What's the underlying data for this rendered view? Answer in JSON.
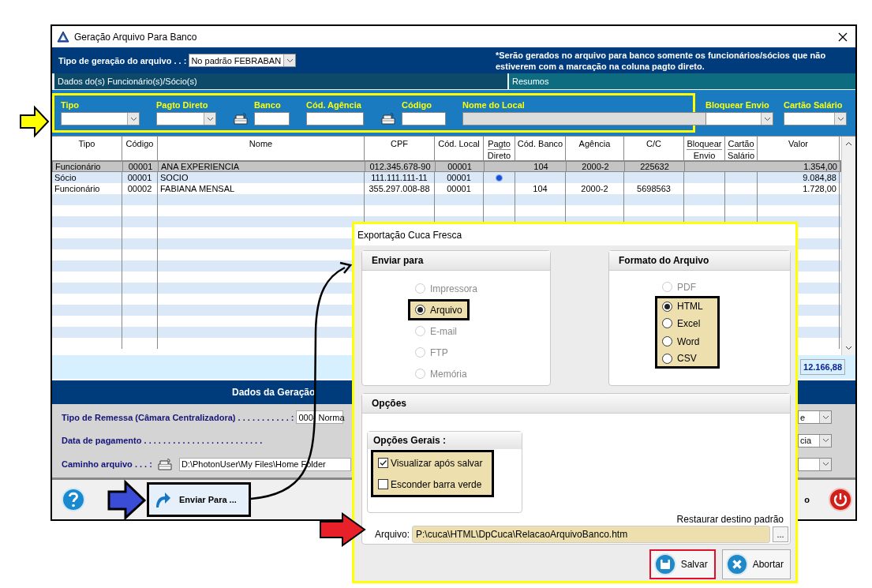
{
  "window": {
    "title": "Geração Arquivo Para Banco"
  },
  "header": {
    "label": "Tipo de geração do arquivo . . :",
    "generation_type": "No padrão FEBRABAN",
    "note": "*Serão gerados no arquivo para banco somente os funcionários/sócios que não estiverem com a marcação na coluna pagto direto."
  },
  "sections": [
    "Dados do(s) Funcionário(s)/Sócio(s)",
    "Resumos"
  ],
  "filters": [
    {
      "label": "Tipo",
      "kind": "select"
    },
    {
      "label": "Pagto Direto",
      "kind": "select"
    },
    {
      "label": "Banco",
      "kind": "lookup"
    },
    {
      "label": "Cód. Agência",
      "kind": "input"
    },
    {
      "label": "Código",
      "kind": "lookup"
    },
    {
      "label": "Nome do Local",
      "kind": "readonly"
    }
  ],
  "side_filters": [
    {
      "label": "Bloquear Envio",
      "kind": "select"
    },
    {
      "label": "Cartão Salário",
      "kind": "select"
    }
  ],
  "table": {
    "columns": [
      {
        "label": "Tipo"
      },
      {
        "label": "Código"
      },
      {
        "label": "Nome"
      },
      {
        "label": "CPF"
      },
      {
        "label": "Cód. Local"
      },
      {
        "label": "Pagto",
        "sublabel": "Direto"
      },
      {
        "label": "Cód. Banco"
      },
      {
        "label": "Agência"
      },
      {
        "label": "C/C"
      },
      {
        "label": "Bloquear",
        "sublabel": "Envio"
      },
      {
        "label": "Cartão",
        "sublabel": "Salário"
      },
      {
        "label": "Valor"
      }
    ],
    "rows": [
      {
        "selected": true,
        "tipo": "Funcionário",
        "codigo": "00001",
        "nome": "ANA EXPERIENCIA",
        "cpf": "012.345.678-90",
        "cod_local": "00001",
        "pagto_direto": false,
        "cod_banco": "104",
        "agencia": "2000-2",
        "cc": "225632",
        "valor": "1.354,00"
      },
      {
        "selected": false,
        "tipo": "Sócio",
        "codigo": "00001",
        "nome": "SOCIO",
        "cpf": "111.111.111-11",
        "cod_local": "00001",
        "pagto_direto": true,
        "valor": "9.084,88"
      },
      {
        "selected": false,
        "tipo": "Funcionário",
        "codigo": "00002",
        "nome": "FABIANA MENSAL",
        "cpf": "355.297.008-88",
        "cod_local": "00001",
        "pagto_direto": false,
        "cod_banco": "104",
        "agencia": "2000-2",
        "cc": "5698563",
        "valor": "1.728,00"
      }
    ]
  },
  "total": "12.166,88",
  "generation": {
    "title": "Dados da Geração",
    "fields": [
      {
        "kind": "select",
        "label": "Tipo de Remessa (Câmara Centralizadora) . . . . . . . . . . . :",
        "value": "000- Norma",
        "tail_value": "e"
      },
      {
        "kind": "date",
        "label": "Data de pagamento . . . . . . . . . . . . . . . . . . . . . . . . .",
        "tail_value": "cia"
      },
      {
        "kind": "path",
        "label": "Caminho arquivo . . . :",
        "value": "D:\\PhotonUser\\My Files\\Home Folder"
      }
    ]
  },
  "footer": {
    "send_button": "Enviar Para ...",
    "label_tail": "o"
  },
  "dialog": {
    "title": "Exportação Cuca Fresca",
    "send_to": {
      "title": "Enviar para",
      "options": [
        {
          "label": "Impressora",
          "selected": false,
          "disabled": true,
          "highlighted": false
        },
        {
          "label": "Arquivo",
          "selected": true,
          "disabled": false,
          "highlighted": true
        },
        {
          "label": "E-mail",
          "selected": false,
          "disabled": true,
          "highlighted": false
        },
        {
          "label": "FTP",
          "selected": false,
          "disabled": true,
          "highlighted": false
        },
        {
          "label": "Memória",
          "selected": false,
          "disabled": true,
          "highlighted": false
        }
      ]
    },
    "format": {
      "title": "Formato do Arquivo",
      "options": [
        {
          "label": "PDF",
          "selected": false,
          "disabled": true,
          "highlighted": false
        },
        {
          "label": "HTML",
          "selected": true,
          "disabled": false,
          "highlighted": true
        },
        {
          "label": "Excel",
          "selected": false,
          "disabled": false,
          "highlighted": true
        },
        {
          "label": "Word",
          "selected": false,
          "disabled": false,
          "highlighted": true
        },
        {
          "label": "CSV",
          "selected": false,
          "disabled": false,
          "highlighted": true
        }
      ]
    },
    "options": {
      "title": "Opções",
      "general_title": "Opções Gerais :",
      "checks": [
        {
          "label": "Visualizar após salvar",
          "checked": true
        },
        {
          "label": "Esconder barra verde",
          "checked": false
        }
      ],
      "restore_link": "Restaurar destino padrão",
      "file_label": "Arquivo:",
      "file_path": "P:\\cuca\\HTML\\DpCuca\\RelacaoArquivoBanco.htm",
      "browse": "..."
    },
    "buttons": [
      {
        "label": "Salvar",
        "kind": "save",
        "highlighted": true
      },
      {
        "label": "Abortar",
        "kind": "abort",
        "highlighted": false
      }
    ]
  }
}
